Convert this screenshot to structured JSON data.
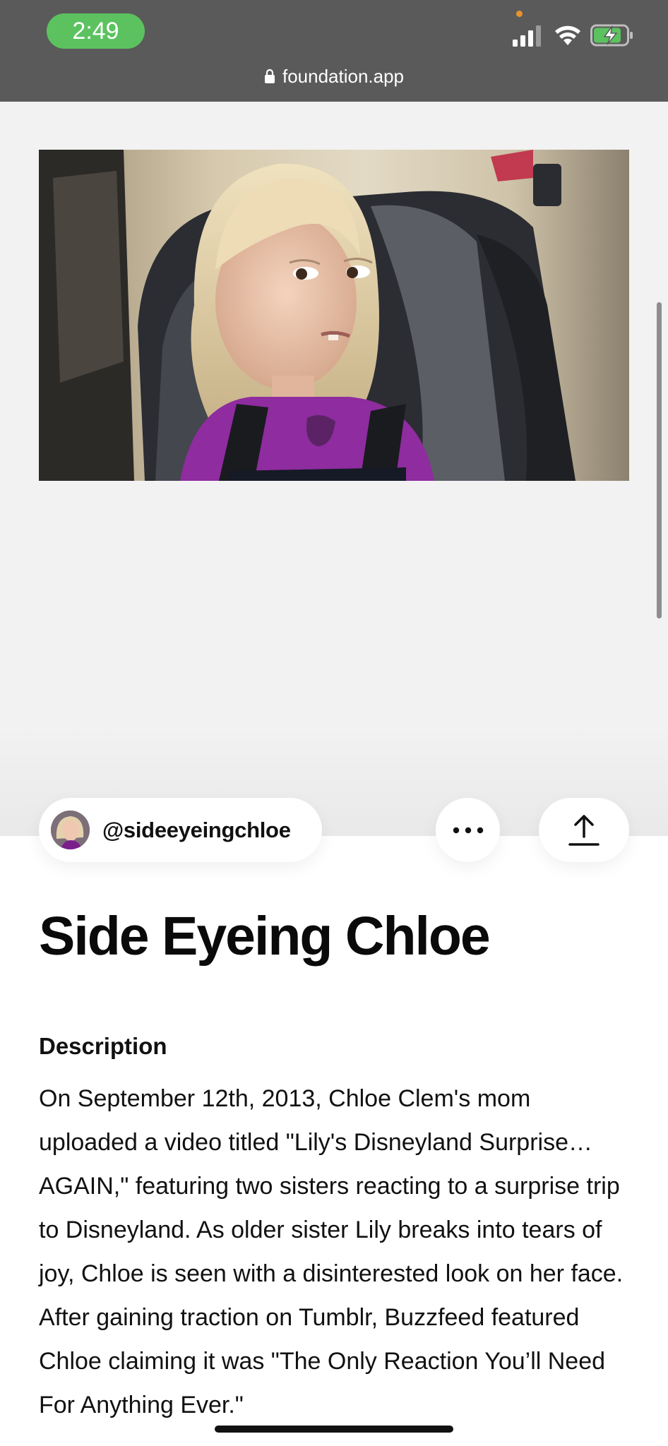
{
  "status_bar": {
    "time": "2:49"
  },
  "browser": {
    "url": "foundation.app"
  },
  "artwork": {
    "alt": "Side Eyeing Chloe"
  },
  "creator": {
    "handle": "@sideeyeingchloe"
  },
  "nft": {
    "title": "Side Eyeing Chloe",
    "description_heading": "Description",
    "description": "On September 12th, 2013, Chloe Clem's mom uploaded a video titled \"Lily's Disneyland Surprise… AGAIN,\" featuring two sisters reacting to a surprise trip to Disneyland. As older sister Lily breaks into tears of joy, Chloe is seen with a disinterested look on her face. After gaining traction on Tumblr, Buzzfeed featured Chloe claiming it was \"The Only Reaction You’ll Need For Anything Ever.\""
  },
  "icons": {
    "status": [
      "signal-icon",
      "wifi-icon",
      "battery-charging-icon"
    ],
    "url_bar": "lock-icon",
    "actions": [
      "more-icon",
      "share-icon"
    ]
  },
  "colors": {
    "status_bar_bg": "#5a5a5a",
    "time_pill": "#5cc25f",
    "battery": "#5cc25f",
    "art_bg": "#f2f2f2"
  }
}
